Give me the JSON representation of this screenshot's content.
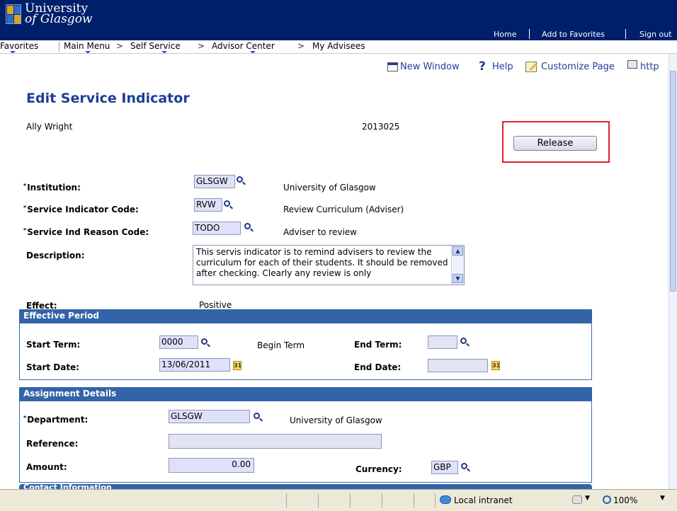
{
  "header": {
    "logo_line1": "University",
    "logo_line2": "of Glasgow",
    "links": [
      "Home",
      "Add to Favorites",
      "Sign out"
    ]
  },
  "nav": {
    "items": [
      "Favorites",
      "Main Menu",
      "Self Service",
      "Advisor Center",
      "My Advisees"
    ],
    "separator": ">"
  },
  "toolbar": {
    "new_window": "New Window",
    "help_glyph": "?",
    "help": "Help",
    "customize": "Customize Page",
    "http": "http"
  },
  "page": {
    "title": "Edit Service Indicator",
    "person_name": "Ally Wright",
    "person_id": "2013025",
    "release_button": "Release"
  },
  "fields": {
    "institution_label": "Institution:",
    "institution_value": "GLSGW",
    "institution_desc": "University of Glasgow",
    "sicode_label": "Service Indicator Code:",
    "sicode_value": "RVW",
    "sicode_desc": "Review Curriculum (Adviser)",
    "reason_label": "Service Ind Reason Code:",
    "reason_value": "TODO",
    "reason_desc": "Adviser to review",
    "description_label": "Description:",
    "description_value": "This servis indicator is to remind advisers to review the curriculum for each of their students.  It should be removed after checking.  Clearly any review is only",
    "effect_label": "Effect:",
    "effect_value": "Positive",
    "required_mark": "*"
  },
  "effective_period": {
    "heading": "Effective Period",
    "start_term_label": "Start Term:",
    "start_term_value": "0000",
    "start_term_desc": "Begin Term",
    "end_term_label": "End Term:",
    "end_term_value": "",
    "start_date_label": "Start Date:",
    "start_date_value": "13/06/2011",
    "end_date_label": "End Date:",
    "end_date_value": "",
    "calendar_glyph": "31"
  },
  "assignment": {
    "heading": "Assignment Details",
    "department_label": "Department:",
    "department_value": "GLSGW",
    "department_desc": "University of Glasgow",
    "reference_label": "Reference:",
    "reference_value": "",
    "amount_label": "Amount:",
    "amount_value": "0.00",
    "currency_label": "Currency:",
    "currency_value": "GBP"
  },
  "contact": {
    "heading": "Contact Information"
  },
  "statusbar": {
    "zone": "Local intranet",
    "zoom": "100%"
  },
  "icons": {
    "lookup": "magnifier-icon",
    "calendar": "calendar-icon",
    "new_window": "new-window-icon",
    "customize": "customize-pencil-icon"
  },
  "colors": {
    "header_bg": "#001f6a",
    "title_blue": "#1c3f94",
    "group_header": "#3364a8",
    "field_bg": "#dfe1fa",
    "highlight_red": "#e0202a"
  }
}
